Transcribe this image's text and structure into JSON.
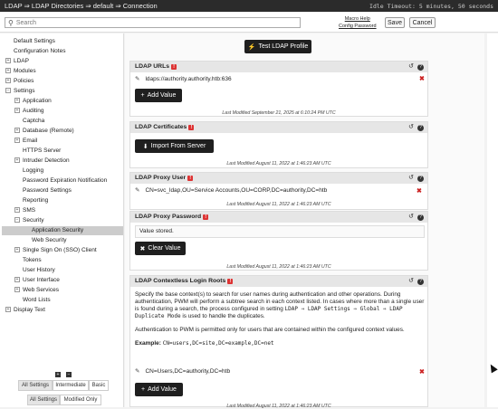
{
  "header": {
    "breadcrumb": "LDAP ⇒ LDAP Directories ⇒ default ⇒ Connection",
    "idle_timeout": "Idle Timeout: 5 minutes, 50 seconds"
  },
  "toolbar": {
    "search_placeholder": "Search",
    "macro_help": "Macro Help",
    "config_password": "Config Password",
    "save_label": "Save",
    "cancel_label": "Cancel"
  },
  "sidebar": {
    "items": [
      {
        "label": "Default Settings"
      },
      {
        "label": "Configuration Notes"
      },
      {
        "label": "LDAP"
      },
      {
        "label": "Modules"
      },
      {
        "label": "Policies"
      },
      {
        "label": "Settings"
      },
      {
        "label": "Application"
      },
      {
        "label": "Auditing"
      },
      {
        "label": "Captcha"
      },
      {
        "label": "Database (Remote)"
      },
      {
        "label": "Email"
      },
      {
        "label": "HTTPS Server"
      },
      {
        "label": "Intruder Detection"
      },
      {
        "label": "Logging"
      },
      {
        "label": "Password Expiration Notification"
      },
      {
        "label": "Password Settings"
      },
      {
        "label": "Reporting"
      },
      {
        "label": "SMS"
      },
      {
        "label": "Security"
      },
      {
        "label": "Application Security"
      },
      {
        "label": "Web Security"
      },
      {
        "label": "Single Sign On (SSO) Client"
      },
      {
        "label": "Tokens"
      },
      {
        "label": "User History"
      },
      {
        "label": "User Interface"
      },
      {
        "label": "Web Services"
      },
      {
        "label": "Word Lists"
      },
      {
        "label": "Display Text"
      }
    ],
    "filters_level": [
      "All Settings",
      "Intermediate",
      "Basic"
    ],
    "filters_mod": [
      "All Settings",
      "Modified Only"
    ]
  },
  "main": {
    "test_button": "Test LDAP Profile",
    "sections": {
      "urls": {
        "title": "LDAP URLs",
        "value": "ldaps://authority.authority.htb:636",
        "button": "Add Value",
        "modified": "Last Modified September 21, 2025 at 6:10:24 PM UTC"
      },
      "certs": {
        "title": "LDAP Certificates",
        "button": "Import From Server",
        "modified": "Last Modified August 11, 2022 at 1:46:23 AM UTC"
      },
      "proxy_user": {
        "title": "LDAP Proxy User",
        "value": "CN=svc_ldap,OU=Service Accounts,OU=CORP,DC=authority,DC=htb",
        "modified": "Last Modified August 11, 2022 at 1:46:23 AM UTC"
      },
      "proxy_pass": {
        "title": "LDAP Proxy Password",
        "value": "Value stored.",
        "button": "Clear Value",
        "modified": "Last Modified August 11, 2022 at 1:46:23 AM UTC"
      },
      "roots": {
        "title": "LDAP Contextless Login Roots",
        "desc1": "Specify the base context(s) to search for user names during authentication and other operations. During authentication, PWM will perform a subtree search in each context listed. In cases where more than a single user is found during a search, the process configured in setting ",
        "desc1_mono": "LDAP ⇒ LDAP Settings ⇒ Global ⇒ LDAP Duplicate Mode",
        "desc1_end": " is used to handle the duplicates.",
        "desc2": "Authentication to PWM is permitted only for users that are contained within the configured context values.",
        "example_label": "Example:",
        "example_value": "CN=users,DC=site,DC=example,DC=net",
        "value": "CN=Users,DC=authority,DC=htb",
        "button": "Add Value",
        "modified": "Last Modified August 11, 2022 at 1:46:23 AM UTC"
      }
    }
  },
  "colors": {
    "topbar": "#2b2b2b",
    "dark_button": "#1f1f1f",
    "warning": "#dd3333",
    "delete": "#cc2222"
  }
}
